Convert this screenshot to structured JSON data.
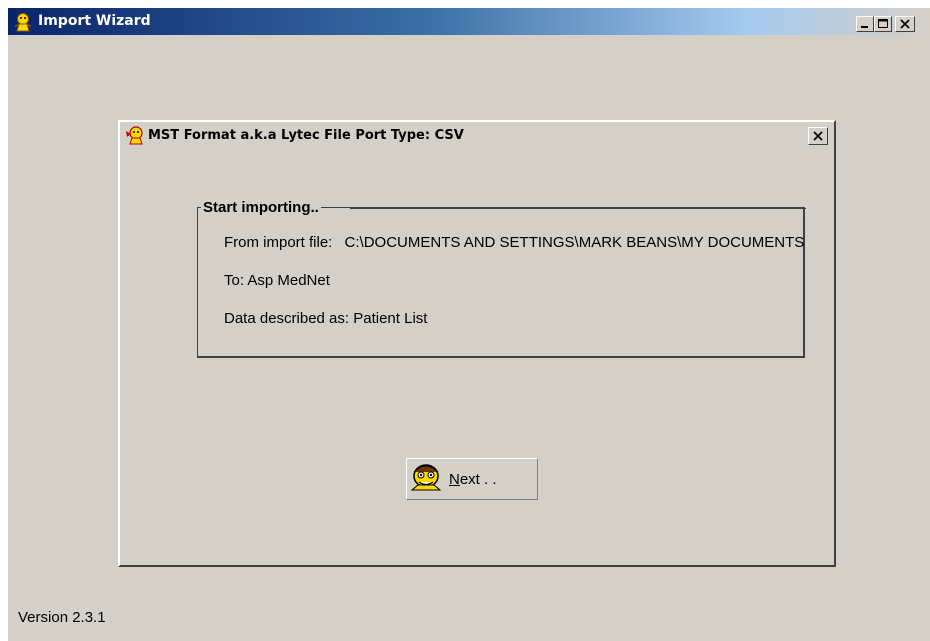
{
  "window": {
    "title": "Import Wizard",
    "icon": "wizard-icon",
    "controls": {
      "minimize": "minimize-icon",
      "maximize": "maximize-icon",
      "close": "close-icon"
    }
  },
  "dialog": {
    "title": "MST Format a.k.a Lytec File Port Type: CSV",
    "icon": "wizard-icon",
    "close": "close-icon"
  },
  "group": {
    "legend": "Start importing..",
    "from_label": "From import file:",
    "from_value": "C:\\DOCUMENTS AND SETTINGS\\MARK BEANS\\MY DOCUMENTS",
    "to_text": "To: Asp MedNet",
    "data_text": "Data described as: Patient List"
  },
  "next_button": {
    "label_mnemonic": "N",
    "label_rest": "ext . .",
    "icon": "wizard-face-icon"
  },
  "footer": {
    "version": "Version 2.3.1"
  },
  "colors": {
    "face": "#d4d0c8",
    "title_active": "#0a246a",
    "title_fade": "#a6caf0"
  }
}
